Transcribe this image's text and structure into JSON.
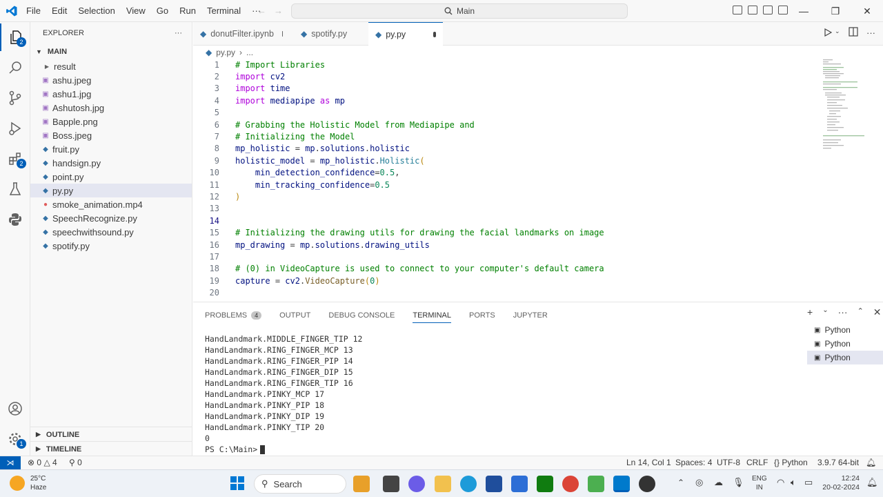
{
  "menu": [
    "File",
    "Edit",
    "Selection",
    "View",
    "Go",
    "Run",
    "Terminal",
    "···"
  ],
  "search_text": "Main",
  "explorer": {
    "title": "EXPLORER",
    "section": "MAIN",
    "items": [
      {
        "label": "result",
        "kind": "folder"
      },
      {
        "label": "ashu.jpeg",
        "kind": "image"
      },
      {
        "label": "ashu1.jpg",
        "kind": "image"
      },
      {
        "label": "Ashutosh.jpg",
        "kind": "image"
      },
      {
        "label": "Bapple.png",
        "kind": "image"
      },
      {
        "label": "Boss.jpeg",
        "kind": "image"
      },
      {
        "label": "fruit.py",
        "kind": "python"
      },
      {
        "label": "handsign.py",
        "kind": "python"
      },
      {
        "label": "point.py",
        "kind": "python"
      },
      {
        "label": "py.py",
        "kind": "python"
      },
      {
        "label": "smoke_animation.mp4",
        "kind": "video"
      },
      {
        "label": "SpeechRecognize.py",
        "kind": "python"
      },
      {
        "label": "speechwithsound.py",
        "kind": "python"
      },
      {
        "label": "spotify.py",
        "kind": "python"
      }
    ],
    "outline": "OUTLINE",
    "timeline": "TIMELINE"
  },
  "tabs": [
    "donutFilter.ipynb",
    "spotify.py",
    "py.py"
  ],
  "breadcrumb": [
    "py.py",
    "..."
  ],
  "code_lines": [
    "# Import Libraries",
    "import cv2",
    "import time",
    "import mediapipe as mp",
    "",
    "# Grabbing the Holistic Model from Mediapipe and",
    "# Initializing the Model",
    "mp_holistic = mp.solutions.holistic",
    "holistic_model = mp_holistic.Holistic(",
    "    min_detection_confidence=0.5,",
    "    min_tracking_confidence=0.5",
    ")",
    "",
    "",
    "# Initializing the drawing utils for drawing the facial landmarks on image",
    "mp_drawing = mp.solutions.drawing_utils",
    "",
    "# (0) in VideoCapture is used to connect to your computer's default camera",
    "capture = cv2.VideoCapture(0)",
    ""
  ],
  "panel": {
    "tabs": [
      "PROBLEMS",
      "OUTPUT",
      "DEBUG CONSOLE",
      "TERMINAL",
      "PORTS",
      "JUPYTER"
    ],
    "problems_count": "4",
    "terminal_lines": [
      "HandLandmark.MIDDLE_FINGER_TIP 12",
      "HandLandmark.RING_FINGER_MCP 13",
      "HandLandmark.RING_FINGER_PIP 14",
      "HandLandmark.RING_FINGER_DIP 15",
      "HandLandmark.RING_FINGER_TIP 16",
      "HandLandmark.PINKY_MCP 17",
      "HandLandmark.PINKY_PIP 18",
      "HandLandmark.PINKY_DIP 19",
      "HandLandmark.PINKY_TIP 20",
      "0"
    ],
    "prompt": "PS C:\\Main>",
    "terminal_list": [
      "Python",
      "Python",
      "Python"
    ]
  },
  "status": {
    "errors": "0",
    "warnings": "4",
    "ports": "0",
    "position": "Ln 14, Col 1",
    "spaces": "Spaces: 4",
    "encoding": "UTF-8",
    "eol": "CRLF",
    "language": "Python",
    "interpreter": "3.9.7 64-bit"
  },
  "taskbar": {
    "weather_temp": "25°C",
    "weather_desc": "Haze",
    "search": "Search",
    "lang1": "ENG",
    "lang2": "IN",
    "time": "12:24",
    "date": "20-02-2024"
  },
  "colors": {
    "accent": "#005fb8",
    "comment": "#008000",
    "keyword": "#af00db"
  }
}
